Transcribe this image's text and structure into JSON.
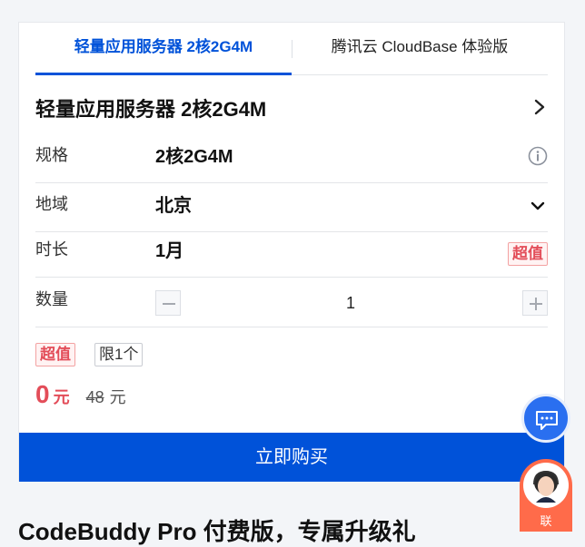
{
  "tabs": [
    {
      "label": "轻量应用服务器 2核2G4M",
      "active": true
    },
    {
      "label": "腾讯云 CloudBase 体验版",
      "active": false
    }
  ],
  "product": {
    "title": "轻量应用服务器 2核2G4M"
  },
  "rows": {
    "spec": {
      "label": "规格",
      "value": "2核2G4M",
      "icon": "info-icon"
    },
    "region": {
      "label": "地域",
      "value": "北京",
      "icon": "chevron-down-icon"
    },
    "duration": {
      "label": "时长",
      "value": "1月",
      "tag": "超值"
    },
    "quantity": {
      "label": "数量",
      "value": "1"
    }
  },
  "tags": {
    "deal": "超值",
    "limit": "限1个"
  },
  "price": {
    "current": "0",
    "current_unit": "元",
    "original": "48",
    "original_unit": "元"
  },
  "buy_button": {
    "label": "立即购买"
  },
  "bottom_heading": "CodeBuddy Pro 付费版，专属升级礼",
  "agent": {
    "label": "联"
  },
  "colors": {
    "primary": "#0052d9",
    "accent_red": "#e34d59"
  }
}
